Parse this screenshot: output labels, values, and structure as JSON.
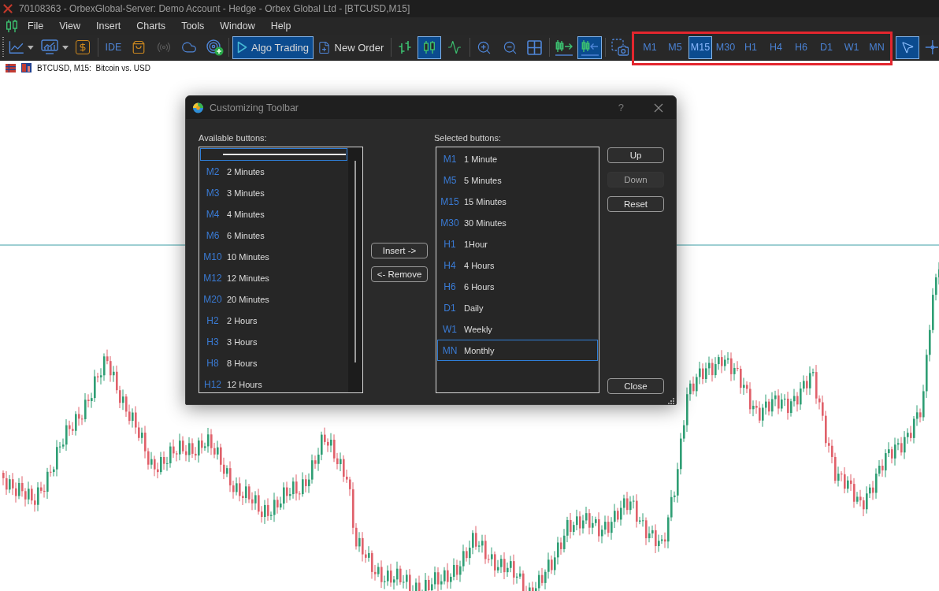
{
  "window": {
    "title": "70108363 - OrbexGlobal-Server: Demo Account - Hedge - Orbex Global Ltd - [BTCUSD,M15]"
  },
  "menu": [
    "File",
    "View",
    "Insert",
    "Charts",
    "Tools",
    "Window",
    "Help"
  ],
  "toolbar": {
    "ide_label": "IDE",
    "signals": {
      "disabled": true
    },
    "algo_trading": {
      "label": "Algo Trading",
      "on": true
    },
    "new_order": {
      "label": "New Order"
    },
    "chart_types": [
      {
        "selected": false
      },
      {
        "selected": true
      },
      {
        "selected": false
      }
    ],
    "chart_shift": {
      "on": false
    },
    "auto_scroll": {
      "on": true
    },
    "timeframes_highlighted": true,
    "timeframes": [
      {
        "label": "M1",
        "selected": false
      },
      {
        "label": "M5",
        "selected": false
      },
      {
        "label": "M15",
        "selected": true
      },
      {
        "label": "M30",
        "selected": false
      },
      {
        "label": "H1",
        "selected": false
      },
      {
        "label": "H4",
        "selected": false
      },
      {
        "label": "H6",
        "selected": false
      },
      {
        "label": "D1",
        "selected": false
      },
      {
        "label": "W1",
        "selected": false
      },
      {
        "label": "MN",
        "selected": false
      }
    ],
    "cursor_modes": [
      {
        "selected": true
      },
      {
        "selected": false
      }
    ]
  },
  "chart": {
    "caption": "BTCUSD, M15:  Bitcoin vs. USD"
  },
  "dialog": {
    "title": "Customizing Toolbar",
    "help": "?",
    "available": {
      "label": "Available buttons:",
      "items": [
        {
          "kind": "separator",
          "selected": true
        },
        {
          "kind": "timeframe",
          "code": "M2",
          "label": "2 Minutes",
          "selected": false
        },
        {
          "kind": "timeframe",
          "code": "M3",
          "label": "3 Minutes",
          "selected": false
        },
        {
          "kind": "timeframe",
          "code": "M4",
          "label": "4 Minutes",
          "selected": false
        },
        {
          "kind": "timeframe",
          "code": "M6",
          "label": "6 Minutes",
          "selected": false
        },
        {
          "kind": "timeframe",
          "code": "M10",
          "label": "10 Minutes",
          "selected": false
        },
        {
          "kind": "timeframe",
          "code": "M12",
          "label": "12 Minutes",
          "selected": false
        },
        {
          "kind": "timeframe",
          "code": "M20",
          "label": "20 Minutes",
          "selected": false
        },
        {
          "kind": "timeframe",
          "code": "H2",
          "label": "2 Hours",
          "selected": false
        },
        {
          "kind": "timeframe",
          "code": "H3",
          "label": "3 Hours",
          "selected": false
        },
        {
          "kind": "timeframe",
          "code": "H8",
          "label": "8 Hours",
          "selected": false
        },
        {
          "kind": "timeframe",
          "code": "H12",
          "label": "12 Hours",
          "selected": false
        }
      ]
    },
    "move_buttons": [
      {
        "label": "Insert ->"
      },
      {
        "label": "<- Remove"
      }
    ],
    "selected": {
      "label": "Selected buttons:",
      "items": [
        {
          "kind": "timeframe",
          "code": "M1",
          "label": "1 Minute",
          "selected": false
        },
        {
          "kind": "timeframe",
          "code": "M5",
          "label": "5 Minutes",
          "selected": false
        },
        {
          "kind": "timeframe",
          "code": "M15",
          "label": "15 Minutes",
          "selected": false
        },
        {
          "kind": "timeframe",
          "code": "M30",
          "label": "30 Minutes",
          "selected": false
        },
        {
          "kind": "timeframe",
          "code": "H1",
          "label": "1Hour",
          "selected": false
        },
        {
          "kind": "timeframe",
          "code": "H4",
          "label": "4 Hours",
          "selected": false
        },
        {
          "kind": "timeframe",
          "code": "H6",
          "label": "6 Hours",
          "selected": false
        },
        {
          "kind": "timeframe",
          "code": "D1",
          "label": "Daily",
          "selected": false
        },
        {
          "kind": "timeframe",
          "code": "W1",
          "label": "Weekly",
          "selected": false
        },
        {
          "kind": "timeframe",
          "code": "MN",
          "label": "Monthly",
          "selected": true
        }
      ]
    },
    "order_buttons": [
      {
        "label": "Up",
        "disabled": false
      },
      {
        "label": "Down",
        "disabled": true
      },
      {
        "label": "Reset",
        "disabled": false
      }
    ],
    "close_button": {
      "label": "Close"
    }
  }
}
